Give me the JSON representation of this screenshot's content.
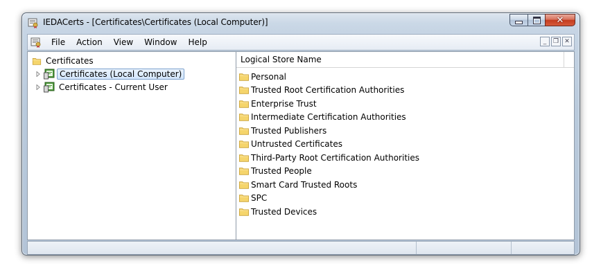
{
  "window": {
    "title": "IEDACerts - [Certificates\\Certificates (Local Computer)]"
  },
  "menu": {
    "items": [
      "File",
      "Action",
      "View",
      "Window",
      "Help"
    ]
  },
  "tree": {
    "root_label": "Certificates",
    "children": [
      {
        "label": "Certificates (Local Computer)",
        "selected": true
      },
      {
        "label": "Certificates - Current User",
        "selected": false
      }
    ]
  },
  "list": {
    "column_header": "Logical Store Name",
    "items": [
      "Personal",
      "Trusted Root Certification Authorities",
      "Enterprise Trust",
      "Intermediate Certification Authorities",
      "Trusted Publishers",
      "Untrusted Certificates",
      "Third-Party Root Certification Authorities",
      "Trusted People",
      "Smart Card Trusted Roots",
      "SPC",
      "Trusted Devices"
    ]
  },
  "colors": {
    "selection_border": "#7da2ce",
    "folder_yellow": "#f5d56c",
    "close_red": "#c43c1f"
  },
  "icons": {
    "app": "certificate-app-icon",
    "folder": "folder-icon",
    "cert_store": "certificate-store-icon",
    "expander": "tree-expander-icon"
  }
}
